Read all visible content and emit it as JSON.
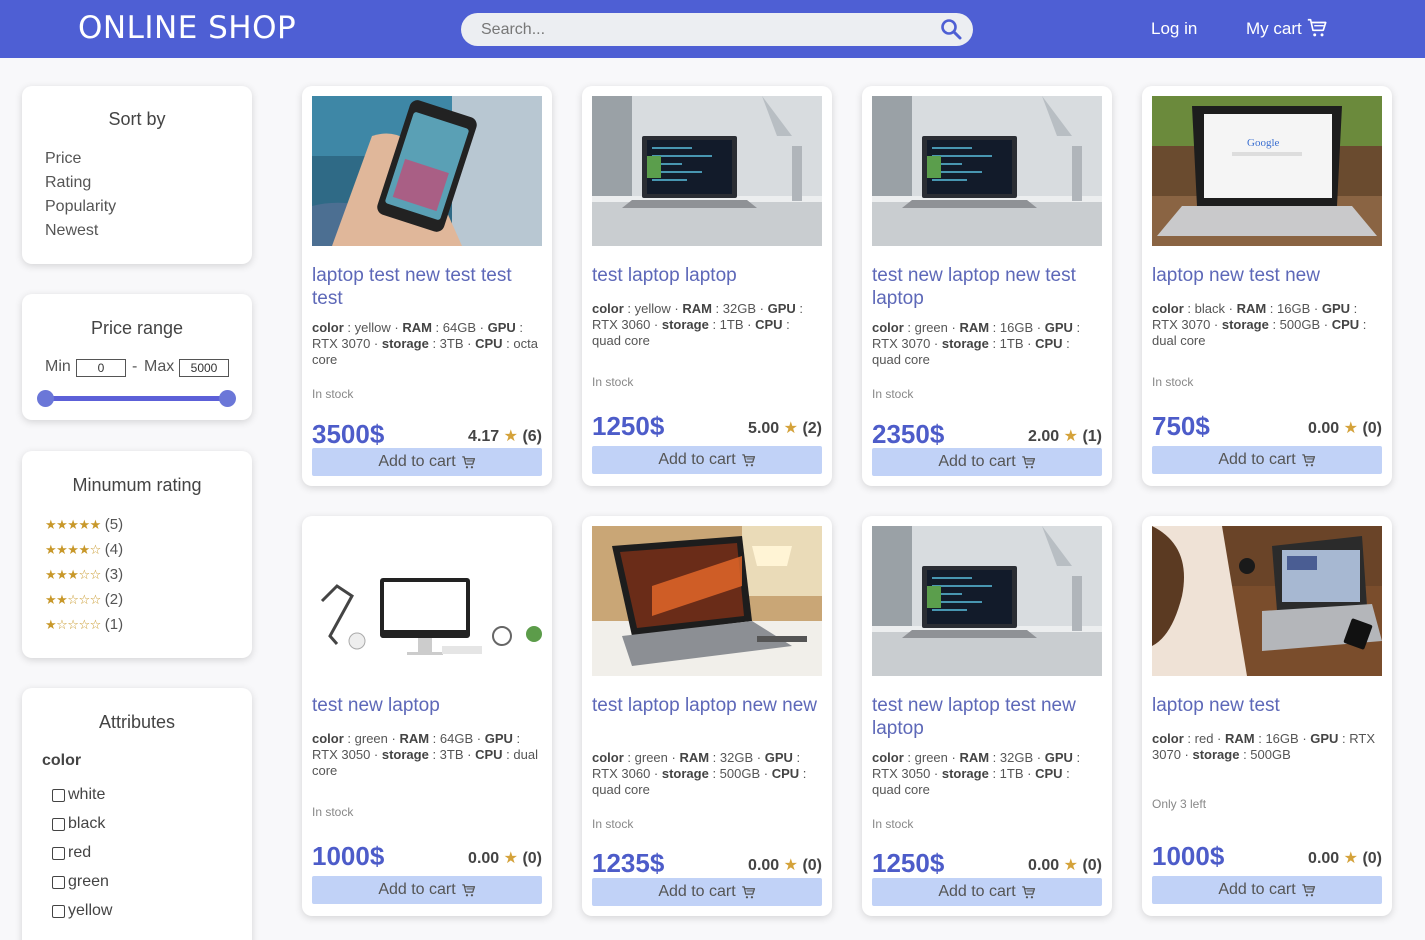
{
  "header": {
    "logo": "ONLINE SHOP",
    "search_placeholder": "Search...",
    "login": "Log in",
    "cart": "My cart"
  },
  "sort": {
    "title": "Sort by",
    "items": [
      "Price",
      "Rating",
      "Popularity",
      "Newest"
    ]
  },
  "price_range": {
    "title": "Price range",
    "min_label": "Min",
    "min_value": "0",
    "separator": "-",
    "max_label": "Max",
    "max_value": "5000"
  },
  "min_rating": {
    "title": "Minumum rating",
    "rows": [
      {
        "stars": "★★★★★",
        "count": "(5)"
      },
      {
        "stars": "★★★★☆",
        "count": "(4)"
      },
      {
        "stars": "★★★☆☆",
        "count": "(3)"
      },
      {
        "stars": "★★☆☆☆",
        "count": "(2)"
      },
      {
        "stars": "★☆☆☆☆",
        "count": "(1)"
      }
    ]
  },
  "attributes": {
    "title": "Attributes",
    "group": "color",
    "options": [
      "white",
      "black",
      "red",
      "green",
      "yellow"
    ]
  },
  "add_to_cart": "Add to cart",
  "products": [
    {
      "name": "laptop test new test test test",
      "color": "yellow",
      "ram": "64GB",
      "gpu": "RTX 3070",
      "storage": "3TB",
      "cpu": "octa core",
      "stock": "In stock",
      "price": "3500$",
      "rating": "4.17",
      "count": "(6)"
    },
    {
      "name": "test laptop laptop",
      "color": "yellow",
      "ram": "32GB",
      "gpu": "RTX 3060",
      "storage": "1TB",
      "cpu": "quad core",
      "stock": "In stock",
      "price": "1250$",
      "rating": "5.00",
      "count": "(2)"
    },
    {
      "name": "test new laptop new test laptop",
      "color": "green",
      "ram": "16GB",
      "gpu": "RTX 3070",
      "storage": "1TB",
      "cpu": "quad core",
      "stock": "In stock",
      "price": "2350$",
      "rating": "2.00",
      "count": "(1)"
    },
    {
      "name": "laptop new test new",
      "color": "black",
      "ram": "16GB",
      "gpu": "RTX 3070",
      "storage": "500GB",
      "cpu": "dual core",
      "stock": "In stock",
      "price": "750$",
      "rating": "0.00",
      "count": "(0)"
    },
    {
      "name": "test new laptop",
      "color": "green",
      "ram": "64GB",
      "gpu": "RTX 3050",
      "storage": "3TB",
      "cpu": "dual core",
      "stock": "In stock",
      "price": "1000$",
      "rating": "0.00",
      "count": "(0)"
    },
    {
      "name": "test laptop laptop new new",
      "color": "green",
      "ram": "32GB",
      "gpu": "RTX 3060",
      "storage": "500GB",
      "cpu": "quad core",
      "stock": "In stock",
      "price": "1235$",
      "rating": "0.00",
      "count": "(0)"
    },
    {
      "name": "test new laptop test new laptop",
      "color": "green",
      "ram": "32GB",
      "gpu": "RTX 3050",
      "storage": "1TB",
      "cpu": "quad core",
      "stock": "In stock",
      "price": "1250$",
      "rating": "0.00",
      "count": "(0)"
    },
    {
      "name": "laptop new test",
      "color": "red",
      "ram": "16GB",
      "gpu": "RTX 3070",
      "storage": "500GB",
      "cpu": null,
      "stock": "Only 3 left",
      "price": "1000$",
      "rating": "0.00",
      "count": "(0)"
    }
  ]
}
